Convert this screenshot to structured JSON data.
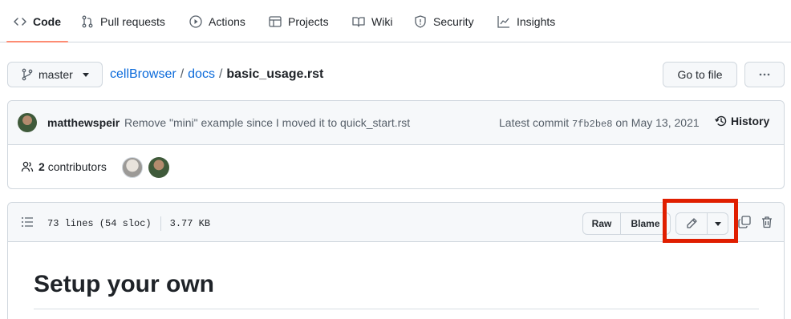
{
  "nav": {
    "tabs": [
      {
        "label": "Code",
        "icon": "code-icon"
      },
      {
        "label": "Pull requests",
        "icon": "git-pull-request-icon"
      },
      {
        "label": "Actions",
        "icon": "play-icon"
      },
      {
        "label": "Projects",
        "icon": "table-icon"
      },
      {
        "label": "Wiki",
        "icon": "book-icon"
      },
      {
        "label": "Security",
        "icon": "shield-icon"
      },
      {
        "label": "Insights",
        "icon": "graph-icon"
      }
    ],
    "active_tab": "Code",
    "active_color": "#fd8c73"
  },
  "branch": {
    "name": "master"
  },
  "breadcrumb": {
    "repo": "cellBrowser",
    "sep": "/",
    "folder": "docs",
    "file": "basic_usage.rst"
  },
  "actions": {
    "goto_label": "Go to file",
    "more_label": "···"
  },
  "commit": {
    "author": "matthewspeir",
    "message": "Remove \"mini\" example since I moved it to quick_start.rst",
    "latest_label": "Latest commit",
    "sha": "7fb2be8",
    "date_text": "on May 13, 2021",
    "history_label": "History"
  },
  "contributors": {
    "count": "2",
    "label": "contributors"
  },
  "file": {
    "lines": "73 lines (54 sloc)",
    "size": "3.77 KB",
    "raw_label": "Raw",
    "blame_label": "Blame",
    "highlight_color": "#e01e00"
  },
  "content": {
    "heading": "Setup your own"
  },
  "colors": {
    "link": "#0969da",
    "border": "#d0d7de",
    "header_bg": "#f6f8fa"
  }
}
